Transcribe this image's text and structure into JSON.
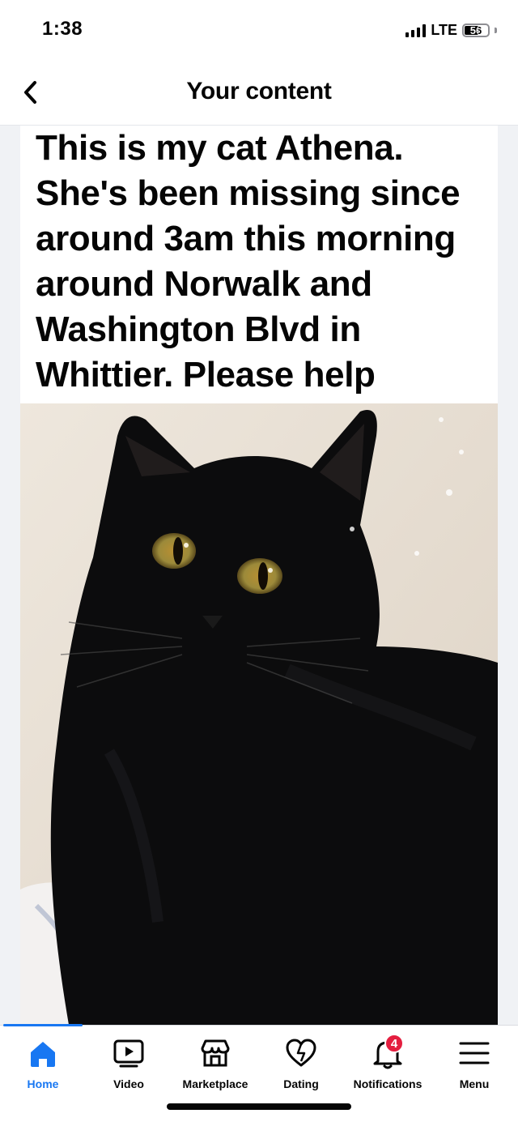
{
  "status_bar": {
    "time": "1:38",
    "network": "LTE",
    "battery": "56"
  },
  "header": {
    "title": "Your content",
    "back_icon": "chevron-left-icon"
  },
  "post": {
    "text": "This is my cat Athena. She's been missing since around 3am this morning around Norwalk and Washington Blvd in Whittier. Please help",
    "photo_subject": "black cat with yellow eyes"
  },
  "tabs": [
    {
      "label": "Home",
      "icon": "home-icon",
      "active": true
    },
    {
      "label": "Video",
      "icon": "video-icon",
      "active": false
    },
    {
      "label": "Marketplace",
      "icon": "marketplace-icon",
      "active": false
    },
    {
      "label": "Dating",
      "icon": "dating-icon",
      "active": false
    },
    {
      "label": "Notifications",
      "icon": "bell-icon",
      "active": false,
      "badge": "4"
    },
    {
      "label": "Menu",
      "icon": "menu-icon",
      "active": false
    }
  ],
  "colors": {
    "accent": "#1877f2",
    "badge": "#e41e3f",
    "text": "#050505"
  }
}
